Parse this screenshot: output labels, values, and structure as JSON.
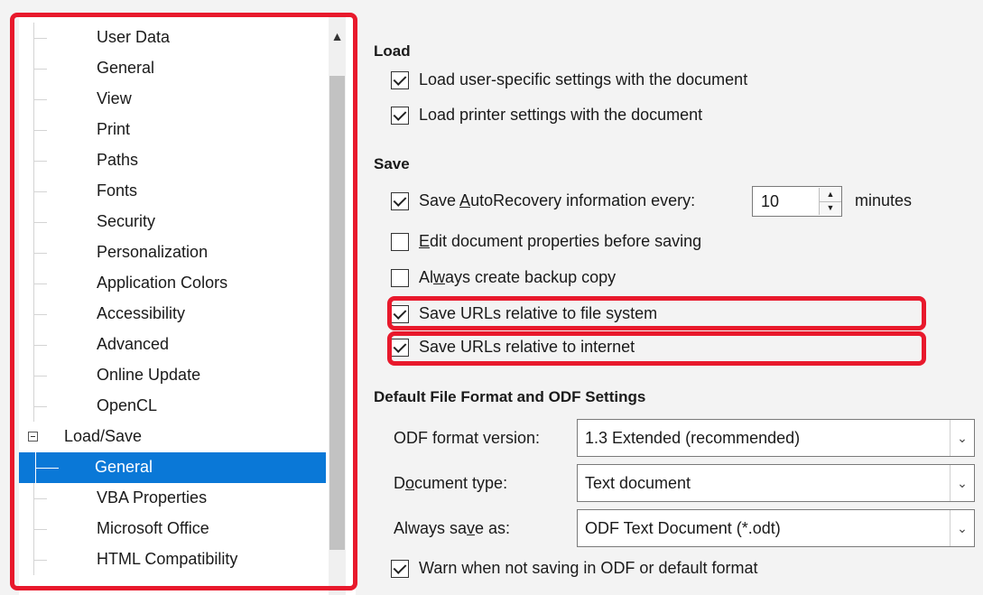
{
  "tree": {
    "items": [
      {
        "label": "User Data"
      },
      {
        "label": "General"
      },
      {
        "label": "View"
      },
      {
        "label": "Print"
      },
      {
        "label": "Paths"
      },
      {
        "label": "Fonts"
      },
      {
        "label": "Security"
      },
      {
        "label": "Personalization"
      },
      {
        "label": "Application Colors"
      },
      {
        "label": "Accessibility"
      },
      {
        "label": "Advanced"
      },
      {
        "label": "Online Update"
      },
      {
        "label": "OpenCL"
      },
      {
        "label": "Load/Save"
      },
      {
        "label": "General"
      },
      {
        "label": "VBA Properties"
      },
      {
        "label": "Microsoft Office"
      },
      {
        "label": "HTML Compatibility"
      }
    ],
    "scroll_up_icon": "▲"
  },
  "load": {
    "heading": "Load",
    "user_settings": "Load user-specific settings with the document",
    "printer_settings": "Load printer settings with the document"
  },
  "save": {
    "heading": "Save",
    "autorecovery_pre": "Save ",
    "autorecovery_u": "A",
    "autorecovery_post": "utoRecovery information every:",
    "autorecovery_value": "10",
    "minutes": "minutes",
    "edit_props_u": "E",
    "edit_props_post": "dit document properties before saving",
    "backup_pre": "Al",
    "backup_u": "w",
    "backup_post": "ays create backup copy",
    "urls_fs": "Save URLs relative to file system",
    "urls_inet": "Save URLs relative to internet"
  },
  "default_format": {
    "heading": "Default File Format and ODF Settings",
    "odf_label": "ODF format version:",
    "odf_value": "1.3 Extended (recommended)",
    "doctype_pre": "D",
    "doctype_u": "o",
    "doctype_post": "cument type:",
    "doctype_value": "Text document",
    "always_pre": "Always sa",
    "always_u": "v",
    "always_post": "e as:",
    "always_value": "ODF Text Document (*.odt)",
    "warn": "Warn when not saving in ODF or default format"
  },
  "colors": {
    "selected_bg": "#0a78d7",
    "highlight": "#e8192c"
  }
}
